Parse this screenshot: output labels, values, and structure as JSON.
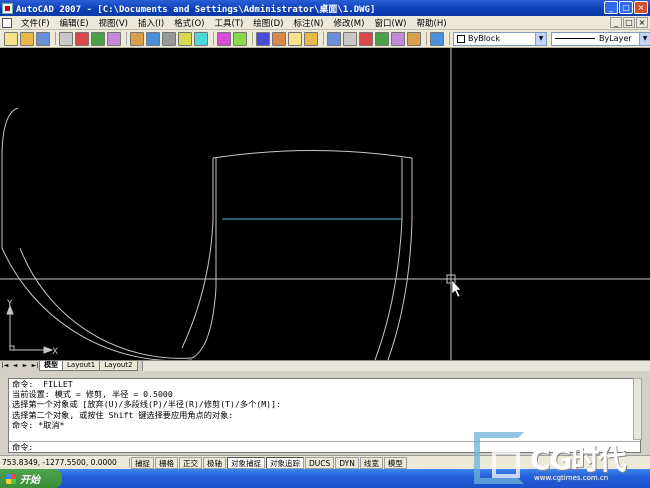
{
  "window": {
    "title": "AutoCAD 2007 - [C:\\Documents and Settings\\Administrator\\桌面\\1.DWG]",
    "buttons": [
      "_",
      "□",
      "×"
    ]
  },
  "menu": {
    "items": [
      "文件(F)",
      "编辑(E)",
      "视图(V)",
      "插入(I)",
      "格式(O)",
      "工具(T)",
      "绘图(D)",
      "标注(N)",
      "修改(M)",
      "窗口(W)",
      "帮助(H)"
    ],
    "doc_buttons": [
      "_",
      "□",
      "×"
    ]
  },
  "toolbar": {
    "color_combo": "ByBlock",
    "linetype_combo": "ByLayer",
    "icon_colors": [
      "#f5e28a",
      "#e8b84a",
      "#6a8fd8",
      "#c9c9c9",
      "#d84a4a",
      "#4aa04a",
      "#c48ad8",
      "#d8a04a",
      "#4a8fd8",
      "#999999",
      "#d8d84a",
      "#4ad8d8",
      "#d84ad8",
      "#8ad84a",
      "#4a4ad8",
      "#d88a4a"
    ]
  },
  "drawing": {
    "background": "#000000",
    "line_color": "#c8c8c8",
    "highlight_color": "#3fb8c4",
    "axis_y": "Y",
    "axis_x": "X"
  },
  "layout_tabs": [
    "模型",
    "Layout1",
    "Layout2"
  ],
  "nav_arrows": [
    "|◄",
    "◄",
    "►",
    "►|"
  ],
  "command": {
    "history": [
      "命令:  FILLET",
      "当前设置: 模式 = 修剪, 半径 = 0.5000",
      "选择第一个对象或 [放弃(U)/多段线(P)/半径(R)/修剪(T)/多个(M)]:",
      "选择第二个对象, 或按住 Shift 键选择要应用角点的对象:",
      "命令: *取消*"
    ],
    "prompt": "命令:"
  },
  "status": {
    "coords": "753.8349,  -1277.5500, 0.0000",
    "buttons": [
      {
        "label": "捕捉",
        "on": false
      },
      {
        "label": "栅格",
        "on": false
      },
      {
        "label": "正交",
        "on": false
      },
      {
        "label": "极轴",
        "on": false
      },
      {
        "label": "对象捕捉",
        "on": true
      },
      {
        "label": "对象追踪",
        "on": true
      },
      {
        "label": "DUCS",
        "on": false
      },
      {
        "label": "DYN",
        "on": false
      },
      {
        "label": "线宽",
        "on": false
      },
      {
        "label": "模型",
        "on": false
      }
    ]
  },
  "taskbar": {
    "start_label": "开始"
  },
  "watermark": {
    "text": "CG时代",
    "url": "www.cgtimes.com.cn"
  }
}
